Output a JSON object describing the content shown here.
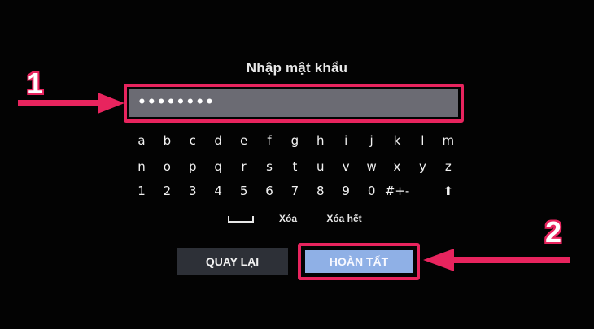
{
  "dialog": {
    "title": "Nhập mật khẩu",
    "password_value": "••••••••"
  },
  "keyboard": {
    "row1": [
      "a",
      "b",
      "c",
      "d",
      "e",
      "f",
      "g",
      "h",
      "i",
      "j",
      "k",
      "l",
      "m"
    ],
    "row2": [
      "n",
      "o",
      "p",
      "q",
      "r",
      "s",
      "t",
      "u",
      "v",
      "w",
      "x",
      "y",
      "z"
    ],
    "row3": [
      "1",
      "2",
      "3",
      "4",
      "5",
      "6",
      "7",
      "8",
      "9",
      "0",
      "#+-",
      "⬆"
    ],
    "space_icon": "space-bar-icon",
    "delete_label": "Xóa",
    "delete_all_label": "Xóa hết"
  },
  "buttons": {
    "back_label": "QUAY LẠI",
    "done_label": "HOÀN TẤT"
  },
  "annotations": {
    "step1": "1",
    "step2": "2",
    "color": "#e8245e"
  }
}
